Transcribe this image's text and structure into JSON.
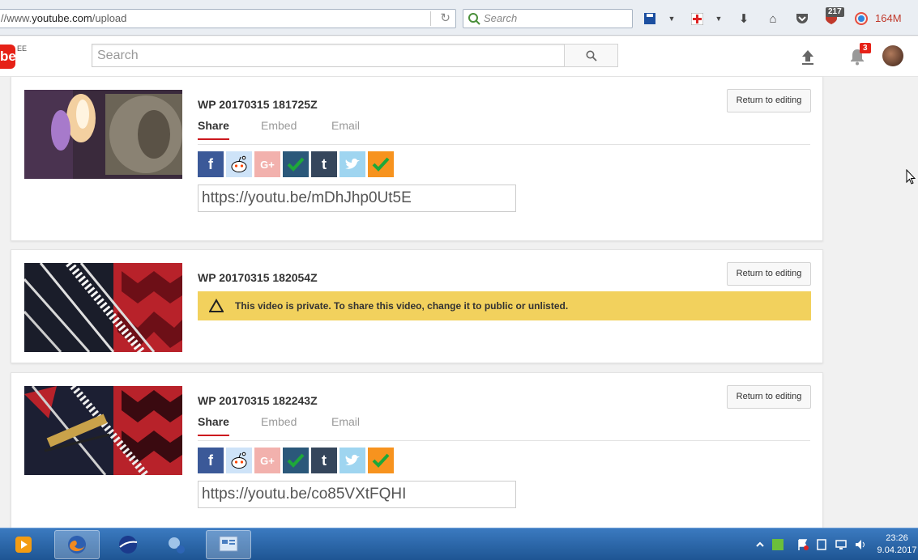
{
  "browser": {
    "url_prefix": "//www.",
    "url_host": "youtube.com",
    "url_path": "/upload",
    "search_placeholder": "Search",
    "tab_count_badge": "217",
    "memory_label": "164M"
  },
  "youtube": {
    "country_code": "EE",
    "logo_text": "be",
    "search_placeholder": "Search",
    "notification_count": "3"
  },
  "videos": [
    {
      "title": "WP 20170315 181725Z",
      "return_label": "Return to editing",
      "tabs": [
        "Share",
        "Embed",
        "Email"
      ],
      "share_url": "https://youtu.be/mDhJhp0Ut5E"
    },
    {
      "title": "WP 20170315 182054Z",
      "return_label": "Return to editing",
      "private_message": "This video is private. To share this video, change it to public or unlisted."
    },
    {
      "title": "WP 20170315 182243Z",
      "return_label": "Return to editing",
      "tabs": [
        "Share",
        "Embed",
        "Email"
      ],
      "share_url": "https://youtu.be/co85VXtFQHI"
    }
  ],
  "social_icons": [
    "facebook-icon",
    "reddit-icon",
    "google-plus-icon",
    "vk-icon",
    "tumblr-icon",
    "twitter-icon",
    "odnoklassniki-icon"
  ],
  "social_glyphs": {
    "google_plus": "G+",
    "tumblr": "t"
  },
  "colors": {
    "accent_red": "#cc181e",
    "youtube_red": "#e62117",
    "warning_yellow": "#f2d15d",
    "facebook": "#3b5998",
    "twitter": "#9fd5f0"
  },
  "taskbar": {
    "time": "23:26",
    "date": "9.04.2017"
  }
}
